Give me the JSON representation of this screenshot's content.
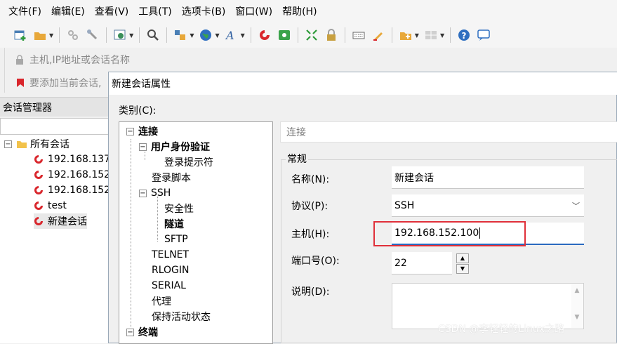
{
  "menu": [
    "文件(F)",
    "编辑(E)",
    "查看(V)",
    "工具(T)",
    "选项卡(B)",
    "窗口(W)",
    "帮助(H)"
  ],
  "address_placeholder": "主机,IP地址或会话名称",
  "hint_text": "要添加当前会话,",
  "session_manager": {
    "title": "会话管理器",
    "root_label": "所有会话",
    "sessions": [
      "192.168.137",
      "192.168.152",
      "192.168.152",
      "test",
      "新建会话"
    ]
  },
  "dialog": {
    "title": "新建会话属性",
    "category_label": "类别(C):",
    "breadcrumb": "连接",
    "group_title": "常规",
    "tree": {
      "connection": "连接",
      "user_auth": "用户身份验证",
      "login_prompt": "登录提示符",
      "login_script": "登录脚本",
      "ssh": "SSH",
      "security": "安全性",
      "tunnel": "隧道",
      "sftp": "SFTP",
      "telnet": "TELNET",
      "rlogin": "RLOGIN",
      "serial": "SERIAL",
      "proxy": "代理",
      "keepalive": "保持活动状态",
      "terminal": "终端"
    },
    "form": {
      "name_label": "名称(N):",
      "name_value": "新建会话",
      "protocol_label": "协议(P):",
      "protocol_value": "SSH",
      "host_label": "主机(H):",
      "host_value": "192.168.152.100",
      "port_label": "端口号(O):",
      "port_value": "22",
      "desc_label": "说明(D):"
    }
  },
  "watermark": "CSDN @李轻轻的Linux之路",
  "colors": {
    "highlight_red": "#e0303a",
    "session_icon": "#d9262c",
    "folder": "#f2c24b"
  }
}
